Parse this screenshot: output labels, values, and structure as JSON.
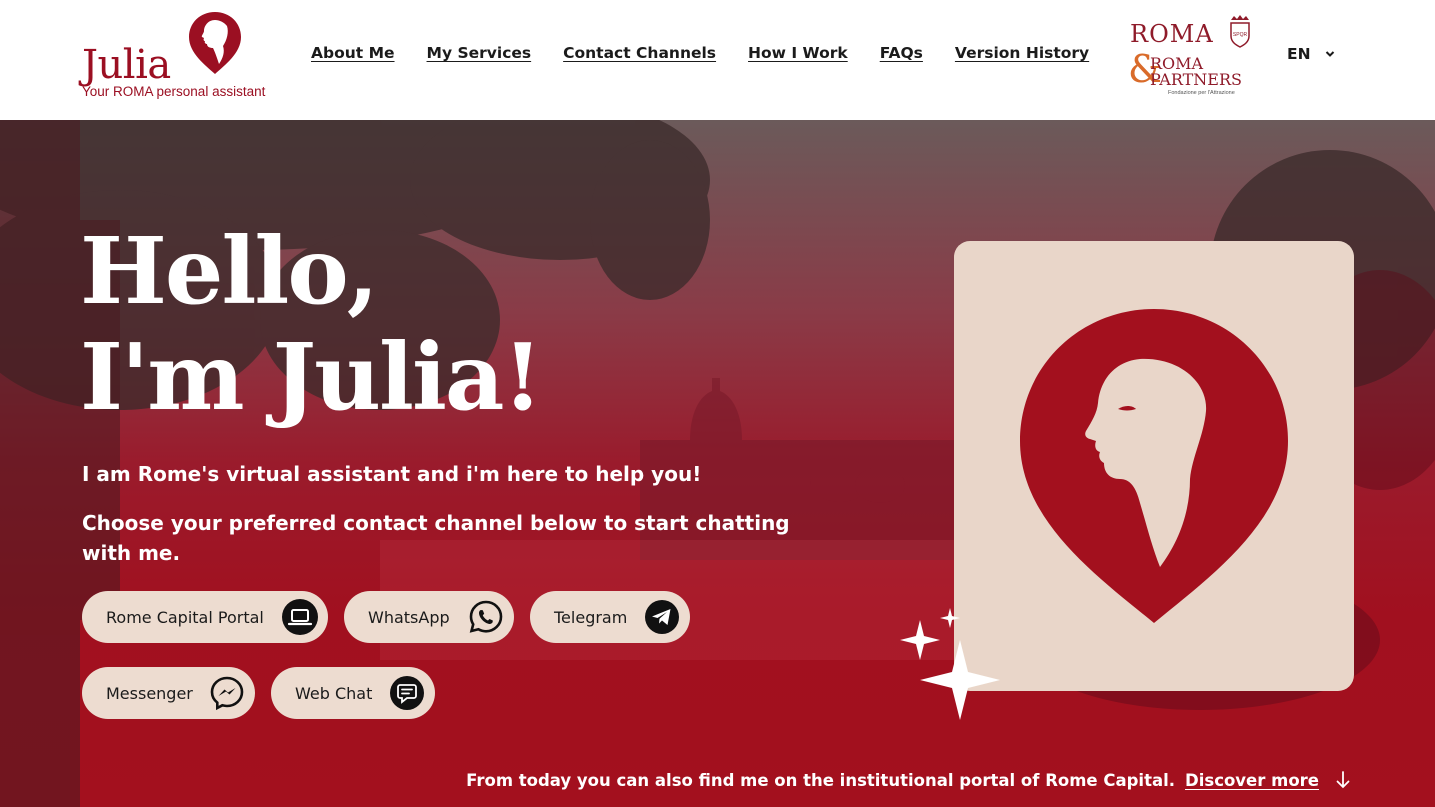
{
  "brand": {
    "name": "Julia",
    "tagline": "Your ROMA personal assistant",
    "color": "#9b0f22"
  },
  "nav": {
    "items": [
      {
        "label": "About Me"
      },
      {
        "label": "My Services"
      },
      {
        "label": "Contact Channels"
      },
      {
        "label": "How I Work"
      },
      {
        "label": "FAQs"
      },
      {
        "label": "Version History"
      }
    ]
  },
  "partner": {
    "line1": "ROMA",
    "line2": "ROMA",
    "line3": "PARTNERS",
    "small": "Fondazione per l'Attrazione",
    "amp": "&"
  },
  "language": {
    "label": "EN",
    "icon": "chevron-down-icon"
  },
  "hero": {
    "title_line1": "Hello,",
    "title_line2": "I'm Julia!",
    "intro": "I am Rome's virtual assistant and i'm here to help you!",
    "instruction": "Choose your preferred contact channel below to start chatting with me.",
    "accent": "#a3101e"
  },
  "channels": [
    {
      "label": "Rome Capital Portal",
      "icon": "laptop-icon"
    },
    {
      "label": "WhatsApp",
      "icon": "whatsapp-icon"
    },
    {
      "label": "Telegram",
      "icon": "telegram-icon"
    },
    {
      "label": "Messenger",
      "icon": "messenger-icon"
    },
    {
      "label": "Web Chat",
      "icon": "chat-icon"
    }
  ],
  "footer": {
    "text": "From today you can also find me on the institutional portal of Rome Capital.",
    "link": "Discover more",
    "icon": "arrow-down-icon"
  }
}
